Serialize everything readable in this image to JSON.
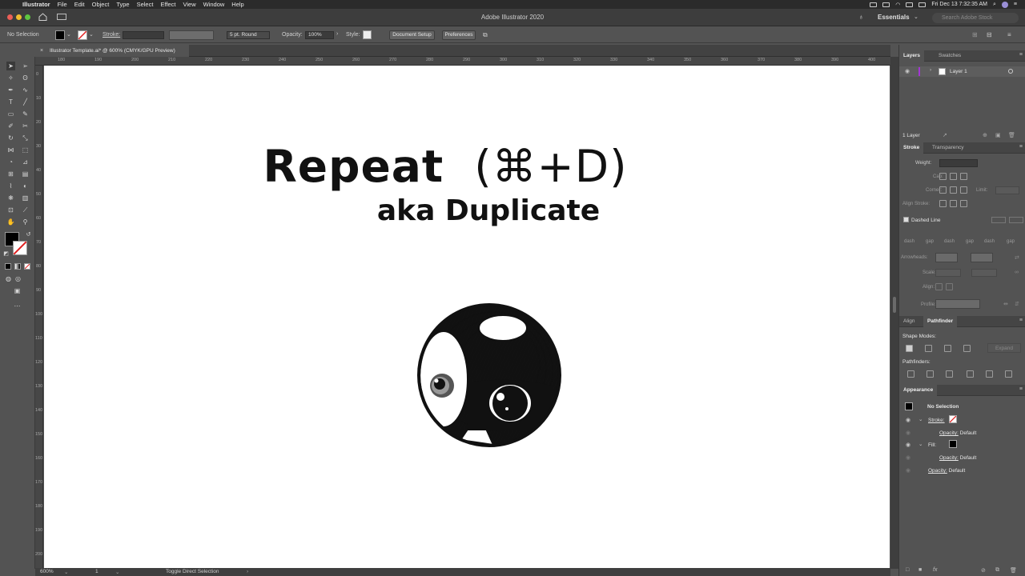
{
  "menubar": {
    "app_name": "Illustrator",
    "items": [
      "File",
      "Edit",
      "Object",
      "Type",
      "Select",
      "Effect",
      "View",
      "Window",
      "Help"
    ],
    "clock": "Fri Dec 13  7:32:35 AM"
  },
  "titlebar": {
    "title": "Adobe Illustrator 2020",
    "workspace": "Essentials",
    "search_placeholder": "Search Adobe Stock"
  },
  "controlbar": {
    "selection": "No Selection",
    "stroke_label": "Stroke:",
    "brush": "5 pt. Round",
    "opacity_label": "Opacity:",
    "opacity_value": "100%",
    "style_label": "Style:",
    "document_setup": "Document Setup",
    "preferences": "Preferences"
  },
  "document": {
    "tab_title": "Illustrator Template.ai* @ 600% (CMYK/GPU Preview)",
    "headline": "Repeat",
    "shortcut": "(⌘+D)",
    "subline": "aka Duplicate"
  },
  "rulers": {
    "top": [
      "180",
      "190",
      "200",
      "210",
      "220",
      "230",
      "240",
      "250",
      "260",
      "270",
      "280",
      "290",
      "300",
      "310",
      "320",
      "330",
      "340",
      "350",
      "360",
      "370",
      "380",
      "390",
      "400"
    ],
    "left": [
      "0",
      "10",
      "20",
      "30",
      "40",
      "50",
      "60",
      "70",
      "80",
      "90",
      "100",
      "110",
      "120",
      "130",
      "140",
      "150",
      "160",
      "170",
      "180",
      "190",
      "200"
    ]
  },
  "statusbar": {
    "zoom": "600%",
    "artboard": "1",
    "tool_hint": "Toggle Direct Selection"
  },
  "layers_panel": {
    "tabs": [
      "Layers",
      "Swatches"
    ],
    "layer_name": "Layer 1",
    "layer_count": "1 Layer"
  },
  "stroke_panel": {
    "tabs": [
      "Stroke",
      "Transparency"
    ],
    "weight_label": "Weight:",
    "cap_label": "Cap:",
    "corner_label": "Corner:",
    "limit_label": "Limit:",
    "align_label": "Align Stroke:",
    "dashed_label": "Dashed Line",
    "dash_labels": [
      "dash",
      "gap",
      "dash",
      "gap",
      "dash",
      "gap"
    ],
    "arrowheads_label": "Arrowheads:",
    "scale_label": "Scale:",
    "align2_label": "Align:",
    "profile_label": "Profile:"
  },
  "pathfinder_panel": {
    "tabs": [
      "Align",
      "Pathfinder"
    ],
    "shape_modes_label": "Shape Modes:",
    "expand_label": "Expand",
    "pathfinders_label": "Pathfinders:"
  },
  "appearance_panel": {
    "tab": "Appearance",
    "header": "No Selection",
    "stroke_label": "Stroke:",
    "fill_label": "Fill:",
    "opacity_label": "Opacity:",
    "opacity_value": "Default"
  },
  "colors": {
    "canvas": "#ffffff",
    "chrome": "#535353",
    "accent_layer": "#a335d6"
  }
}
